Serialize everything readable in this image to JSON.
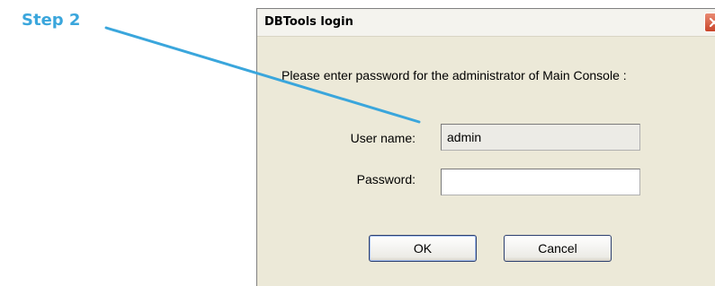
{
  "annotation": {
    "step_label": "Step 2",
    "color": "#3aa6dc"
  },
  "dialog": {
    "title": "DBTools login",
    "close_icon": "close-icon",
    "prompt": "Please enter password for the administrator of Main Console :",
    "username_label": "User name:",
    "username_value": "admin",
    "password_label": "Password:",
    "password_value": "",
    "ok_label": "OK",
    "cancel_label": "Cancel",
    "colors": {
      "face": "#ece9d8",
      "close_button": "#d9533a"
    }
  }
}
